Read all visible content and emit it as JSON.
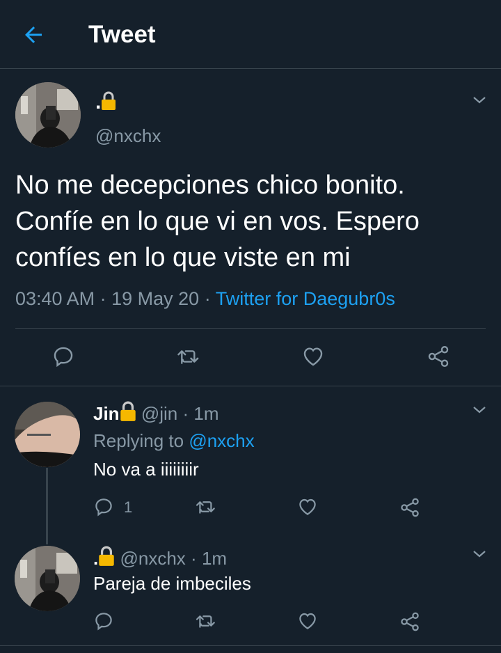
{
  "header": {
    "title": "Tweet"
  },
  "tweet": {
    "name": ".🔒",
    "handle": "@nxchx",
    "text": "No me decepciones chico bonito. Confíe en lo que vi en vos. Espero confíes en lo que viste en mi",
    "time": "03:40 AM",
    "date": "19 May 20",
    "source": "Twitter for Daegubr0s",
    "dot": "·"
  },
  "replies": [
    {
      "name": "Jin",
      "handle": "@jin",
      "age": "1m",
      "replying_prefix": "Replying to",
      "replying_to": "@nxchx",
      "text": "No va a iiiiiiiir",
      "reply_count": "1"
    },
    {
      "name": ".",
      "handle": "@nxchx",
      "age": "1m",
      "text": "Pareja de imbeciles"
    }
  ],
  "colors": {
    "background": "#15202b",
    "accent": "#1da1f2",
    "muted": "#8899a6",
    "divider": "#38444d",
    "lock": "#f5b800"
  }
}
